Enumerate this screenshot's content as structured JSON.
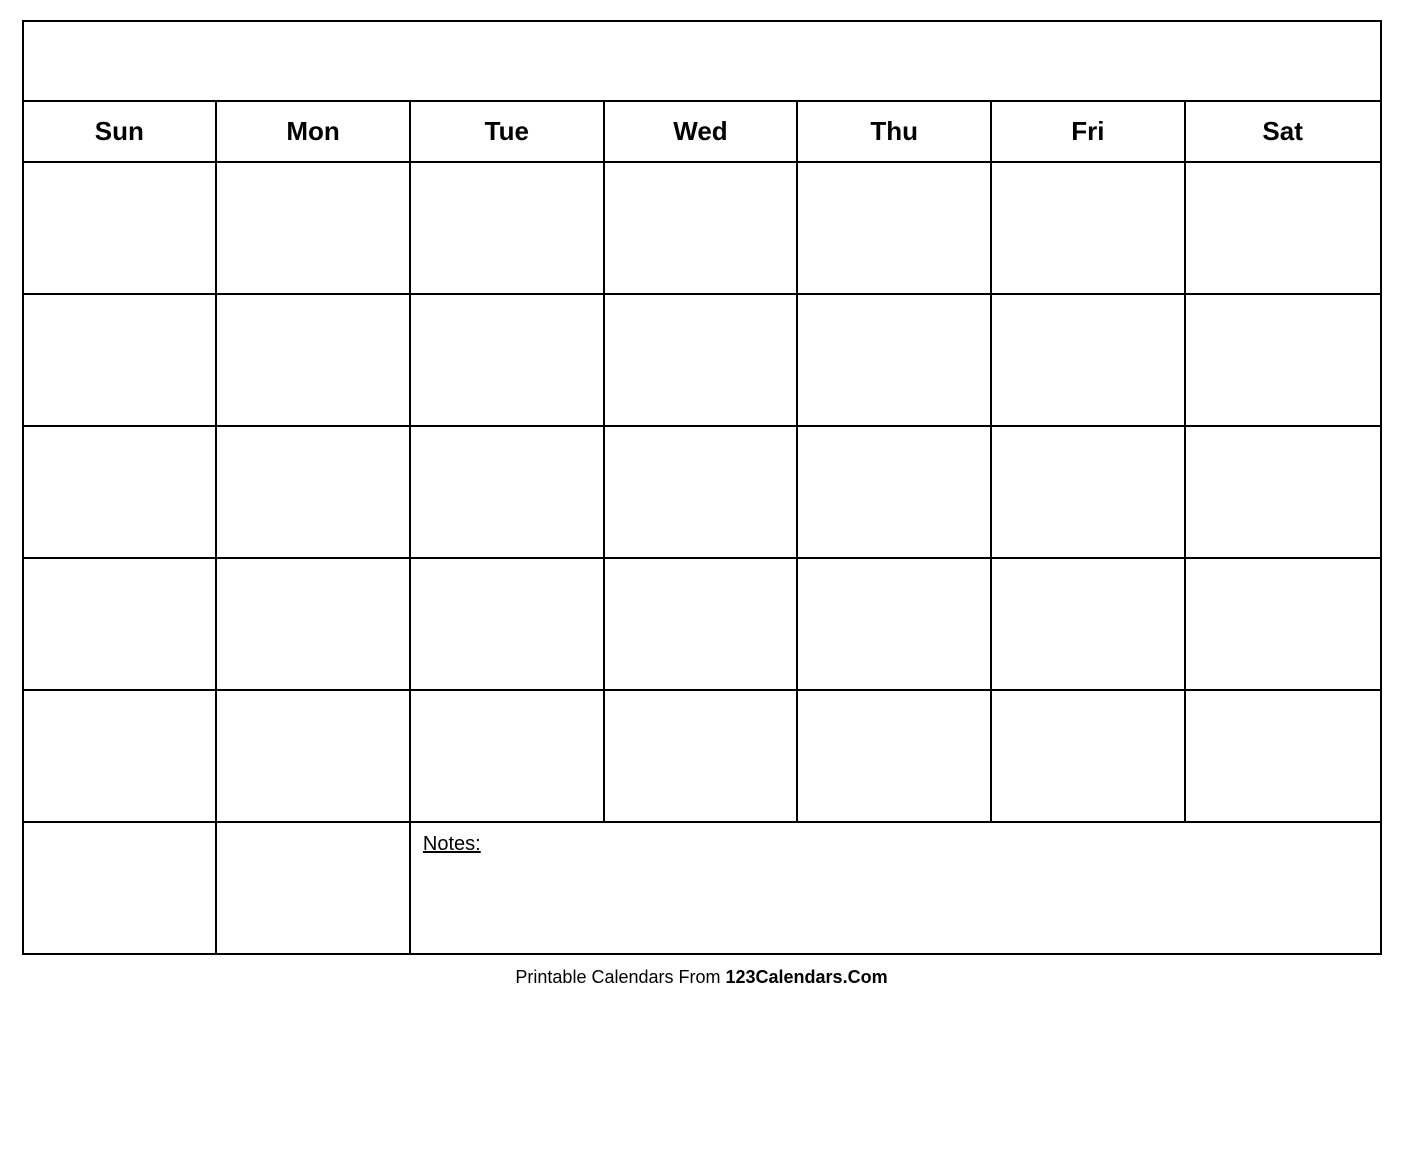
{
  "calendar": {
    "title": "",
    "headers": [
      "Sun",
      "Mon",
      "Tue",
      "Wed",
      "Thu",
      "Fri",
      "Sat"
    ],
    "rows": [
      [
        "",
        "",
        "",
        "",
        "",
        "",
        ""
      ],
      [
        "",
        "",
        "",
        "",
        "",
        "",
        ""
      ],
      [
        "",
        "",
        "",
        "",
        "",
        "",
        ""
      ],
      [
        "",
        "",
        "",
        "",
        "",
        "",
        ""
      ],
      [
        "",
        "",
        "",
        "",
        "",
        "",
        ""
      ]
    ],
    "notes_label": "Notes:",
    "notes_empty_cells": 2
  },
  "footer": {
    "text_plain": "Printable Calendars From ",
    "text_bold": "123Calendars.Com"
  }
}
